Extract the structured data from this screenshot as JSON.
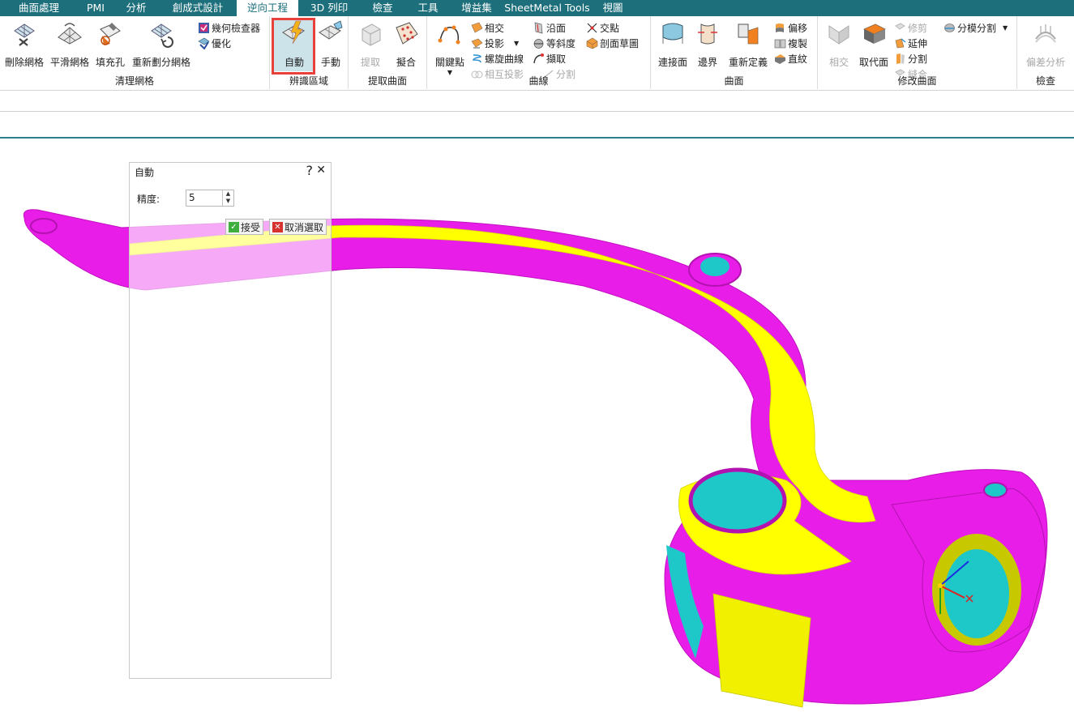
{
  "menu": {
    "tabs": [
      "曲面處理",
      "PMI",
      "分析",
      "創成式設計",
      "逆向工程",
      "3D 列印",
      "檢查",
      "工具",
      "增益集",
      "SheetMetal Tools",
      "視圖"
    ],
    "active_index": 4
  },
  "ribbon": {
    "clean_mesh": {
      "label": "清理網格",
      "delete_mesh": "刪除網格",
      "smooth_mesh": "平滑網格",
      "fill_hole": "填充孔",
      "remesh": "重新劃分網格",
      "geometry_checker": "幾何檢查器",
      "optimize": "優化"
    },
    "identify_region": {
      "label": "辨識區域",
      "auto": "自動",
      "manual": "手動"
    },
    "extract_surface": {
      "label": "提取曲面",
      "extract": "提取",
      "fit": "擬合"
    },
    "curves": {
      "label": "曲線",
      "key_points": "關鍵點",
      "intersect": "相交",
      "project": "投影",
      "spiral": "螺旋曲線",
      "mutual_project": "相互投影",
      "along_face": "沿面",
      "isocline": "等斜度",
      "extract": "擷取",
      "split": "分割",
      "intersection_point": "交點",
      "section_sketch": "剖面草圖"
    },
    "surfaces": {
      "label": "曲面",
      "blend": "連接面",
      "boundary": "邊界",
      "redefine": "重新定義",
      "offset": "偏移",
      "copy": "複製",
      "ruled": "直紋"
    },
    "modify_surface": {
      "label": "修改曲面",
      "intersect": "相交",
      "replace_face": "取代面",
      "trim": "修剪",
      "extend": "延伸",
      "split": "分割",
      "stitch": "縫合",
      "parting_split": "分模分割"
    },
    "inspect": {
      "label": "檢查",
      "deviation": "偏差分析"
    }
  },
  "dialog": {
    "title": "自動",
    "help": "?",
    "close": "✕",
    "precision_label": "精度:",
    "precision_value": "5",
    "accept": "接受",
    "cancel_selection": "取消選取"
  },
  "colors": {
    "menubar": "#1d6f7c",
    "highlight_box": "#e8413c",
    "model_magenta": "#e81ee8",
    "model_yellow": "#ffff00",
    "model_cyan": "#1ec8c8"
  },
  "icons": [
    "delete-mesh-icon",
    "smooth-mesh-icon",
    "fill-hole-icon",
    "remesh-icon",
    "geometry-checker-icon",
    "optimize-icon",
    "auto-region-icon",
    "manual-region-icon",
    "extract-icon",
    "fit-icon",
    "key-points-icon",
    "blend-icon",
    "boundary-icon",
    "redefine-icon",
    "intersect-icon",
    "replace-face-icon",
    "deviation-icon",
    "accept-icon",
    "cancel-icon"
  ]
}
